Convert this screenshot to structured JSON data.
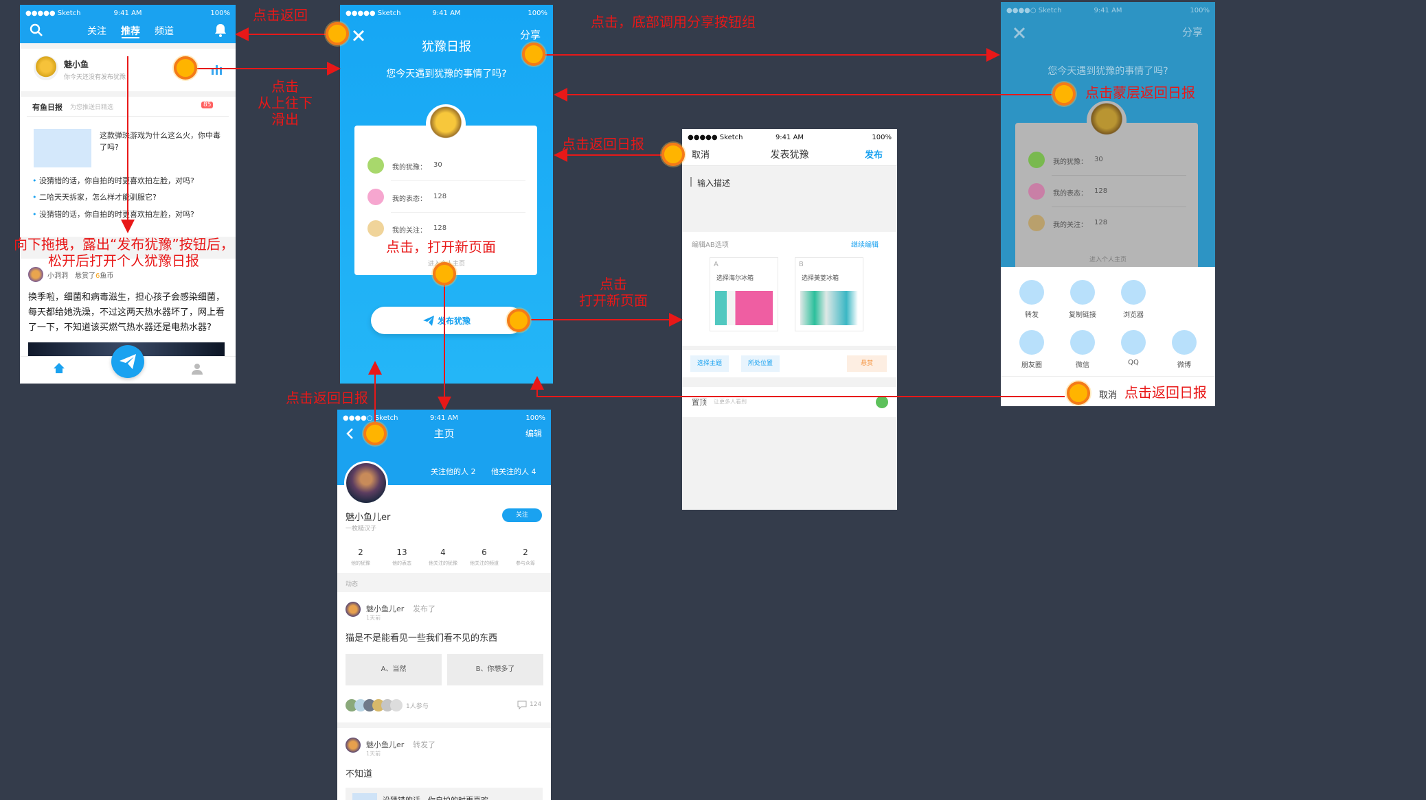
{
  "status": {
    "carrier": "●●●●● Sketch",
    "carrier_s": "●●●●○ Sketch",
    "time": "9:41 AM",
    "battery": "100%"
  },
  "s1": {
    "tabs": [
      "关注",
      "推荐",
      "频道"
    ],
    "user": "魅小鱼",
    "subtitle": "你今天还没有发布犹豫",
    "section": "有鱼日报",
    "section_sub": "为您推送日精选",
    "badge": "85",
    "card_title": "这款弹珠游戏为什么这么火，你中毒了吗?",
    "bullets": [
      "没猜错的话，你自拍的时更喜欢拍左脸，对吗?",
      "二哈天天拆家，怎么样才能驯服它?",
      "没猜错的话，你自拍的时更喜欢拍左脸，对吗?"
    ],
    "post_user": "小洞洞",
    "post_reward_a": "悬赏了",
    "post_reward_b": "6",
    "post_reward_c": "鱼币",
    "post_text": "换季啦，细菌和病毒滋生，担心孩子会感染细菌，每天都给她洗澡，不过这两天热水器坏了，网上看了一下，不知道该买燃气热水器还是电热水器?"
  },
  "s2": {
    "title": "犹豫日报",
    "share": "分享",
    "question": "您今天遇到犹豫的事情了吗?",
    "stats": [
      {
        "label": "我的犹豫：",
        "value": "30",
        "color": "#a8d86c"
      },
      {
        "label": "我的表态：",
        "value": "128",
        "color": "#f6a6cf"
      },
      {
        "label": "我的关注：",
        "value": "128",
        "color": "#f0d49a"
      }
    ],
    "enter": "进入个人主页",
    "publish": "发布犹豫"
  },
  "s3": {
    "title": "主页",
    "edit": "编辑",
    "followers_label": "关注他的人",
    "followers": "2",
    "following_label": "他关注的人",
    "following": "4",
    "name": "魅小鱼儿er",
    "sub": "一枚糙汉子",
    "follow": "关注",
    "counts": [
      {
        "n": "2",
        "l": "他的犹豫"
      },
      {
        "n": "13",
        "l": "他的表态"
      },
      {
        "n": "4",
        "l": "他关注的犹豫"
      },
      {
        "n": "6",
        "l": "他关注的频道"
      },
      {
        "n": "2",
        "l": "参与众筹"
      }
    ],
    "section": "动态",
    "p1_user": "魅小鱼儿er",
    "p1_action": "发布了",
    "p1_time": "1天前",
    "p1_text": "猫是不是能看见一些我们看不见的东西",
    "opt_a": "A、当然",
    "opt_b": "B、你想多了",
    "joined": "1人参与",
    "comments": "124",
    "p2_user": "魅小鱼儿er",
    "p2_action": "转发了",
    "p2_time": "1天前",
    "p2_text": "不知道",
    "p2_quote": "没猜错的话，你自拍的时更喜欢"
  },
  "s4": {
    "cancel": "取消",
    "title": "发表犹豫",
    "publish": "发布",
    "input": "输入描述",
    "ab": "编辑AB选项",
    "continue": "继续编辑",
    "opt_a_letter": "A",
    "opt_a": "选择海尔冰箱",
    "opt_b_letter": "B",
    "opt_b": "选择美菱冰箱",
    "tag_topic": "选择主题",
    "tag_loc": "所处位置",
    "tag_reward": "悬赏",
    "top": "置顶",
    "top_sub": "让更多人看到"
  },
  "s5": {
    "share": "分享",
    "question": "您今天遇到犹豫的事情了吗?",
    "stats": [
      {
        "label": "我的犹豫：",
        "value": "30",
        "color": "#79b94f"
      },
      {
        "label": "我的表态：",
        "value": "128",
        "color": "#c97fa6"
      },
      {
        "label": "我的关注：",
        "value": "128",
        "color": "#b9a06c"
      }
    ],
    "enter": "进入个人主页",
    "icons": [
      "转发",
      "复制链接",
      "浏览器",
      "朋友圈",
      "微信",
      "QQ",
      "微博"
    ],
    "cancel": "取消"
  },
  "ann": {
    "back": "点击返回",
    "open_share": "点击，底部调用分享按钮组",
    "slide_a": "点击",
    "slide_b": "从上往下",
    "slide_c": "滑出",
    "back_daily1": "点击返回日报",
    "drag_a": "向下拖拽，露出“发布犹豫”按钮后，",
    "drag_b": "松开后打开个人犹豫日报",
    "open_new": "点击，打开新页面",
    "open_new2_a": "点击",
    "open_new2_b": "打开新页面",
    "back_daily2": "点击返回日报",
    "back_blank": "点击蒙层返回日报",
    "back_daily3": "点击返回日报"
  }
}
